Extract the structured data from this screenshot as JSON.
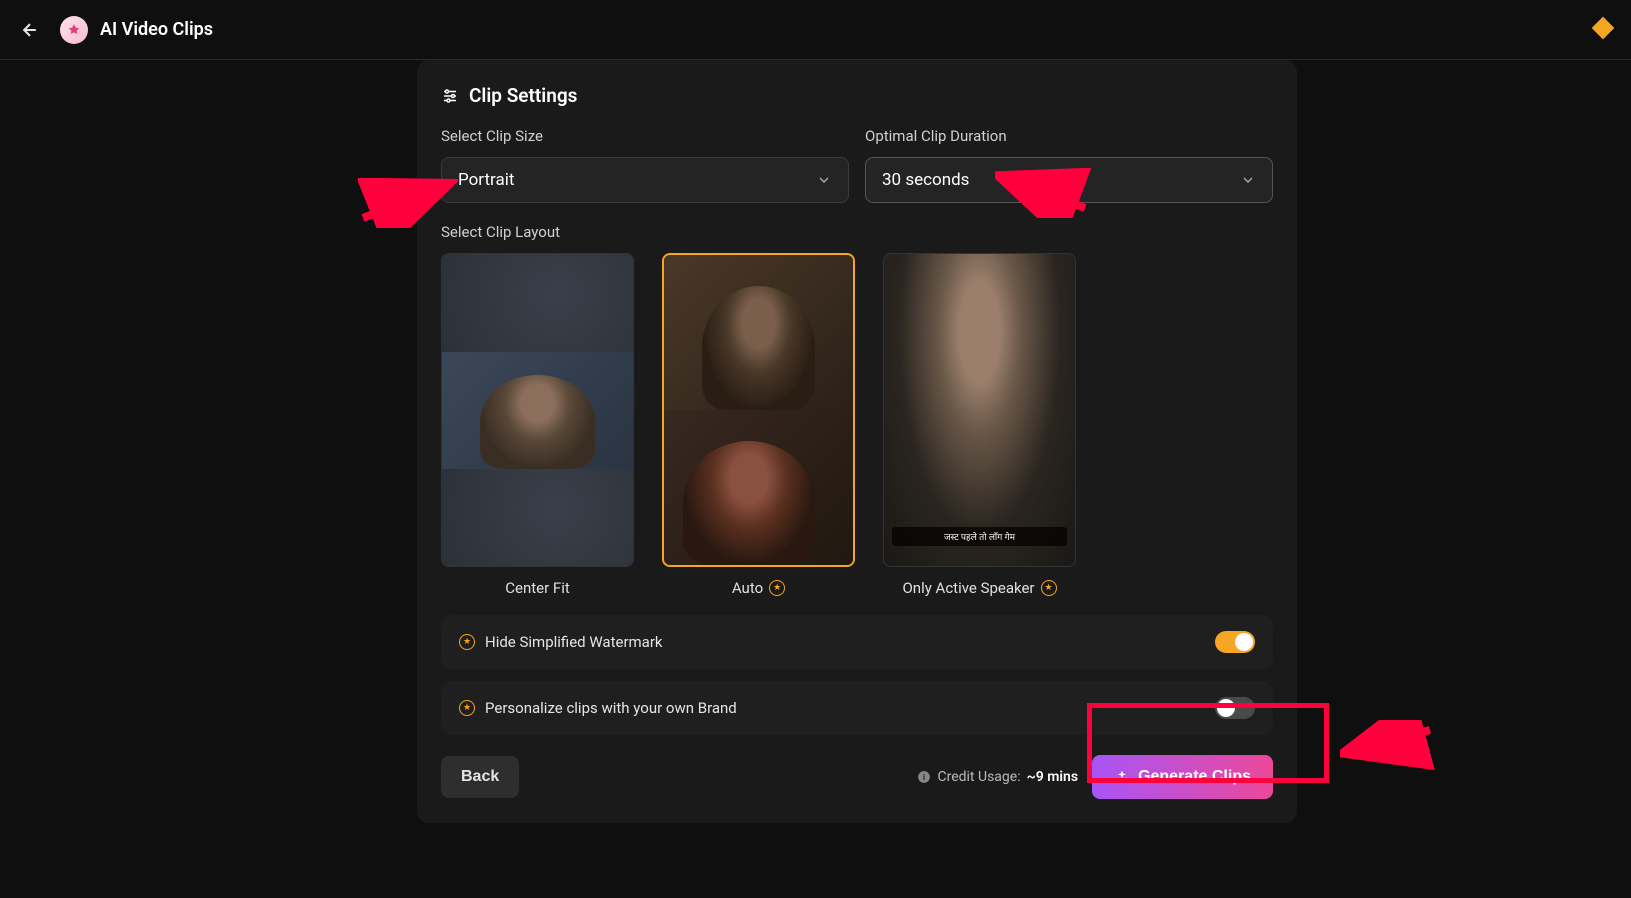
{
  "header": {
    "title": "AI Video Clips"
  },
  "settings": {
    "section_title": "Clip Settings",
    "clip_size": {
      "label": "Select Clip Size",
      "value": "Portrait"
    },
    "duration": {
      "label": "Optimal Clip Duration",
      "value": "30 seconds"
    },
    "layout": {
      "label": "Select Clip Layout",
      "options": [
        {
          "label": "Center Fit",
          "premium": false,
          "selected": false
        },
        {
          "label": "Auto",
          "premium": true,
          "selected": true
        },
        {
          "label": "Only Active Speaker",
          "premium": true,
          "selected": false,
          "caption": "जस्ट पहले तो लाँग गेम"
        }
      ]
    },
    "watermark": {
      "label": "Hide Simplified Watermark",
      "on": true,
      "premium": true
    },
    "brand": {
      "label": "Personalize clips with your own Brand",
      "on": false,
      "premium": true
    }
  },
  "footer": {
    "back_label": "Back",
    "credit_label": "Credit Usage:",
    "credit_value": "~9 mins",
    "generate_label": "Generate Clips"
  }
}
